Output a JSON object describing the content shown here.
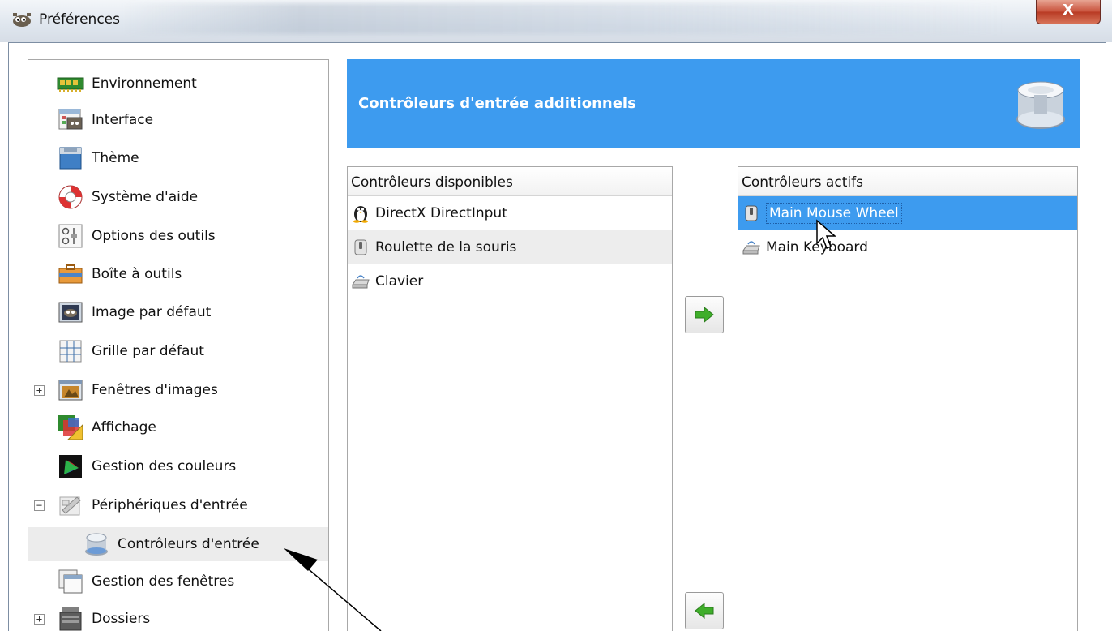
{
  "window": {
    "title": "Préférences",
    "close_label": "X"
  },
  "sidebar": {
    "items": [
      {
        "label": "Environnement",
        "icon": "memory-chip-icon"
      },
      {
        "label": "Interface",
        "icon": "interface-icon"
      },
      {
        "label": "Thème",
        "icon": "theme-icon"
      },
      {
        "label": "Système d'aide",
        "icon": "lifebuoy-icon"
      },
      {
        "label": "Options des outils",
        "icon": "tool-options-icon"
      },
      {
        "label": "Boîte à outils",
        "icon": "toolbox-icon"
      },
      {
        "label": "Image par défaut",
        "icon": "default-image-icon"
      },
      {
        "label": "Grille par défaut",
        "icon": "grid-icon"
      },
      {
        "label": "Fenêtres d'images",
        "icon": "image-windows-icon",
        "expander": "+"
      },
      {
        "label": "Affichage",
        "icon": "display-icon"
      },
      {
        "label": "Gestion des couleurs",
        "icon": "color-management-icon"
      },
      {
        "label": "Périphériques d'entrée",
        "icon": "input-devices-icon",
        "expander": "−"
      },
      {
        "label": "Contrôleurs d'entrée",
        "icon": "input-controllers-icon",
        "selected": true
      },
      {
        "label": "Gestion des fenêtres",
        "icon": "window-management-icon"
      },
      {
        "label": "Dossiers",
        "icon": "folders-icon",
        "expander": "+"
      }
    ]
  },
  "banner": {
    "title": "Contrôleurs d'entrée additionnels",
    "icon": "input-controller-large-icon"
  },
  "available": {
    "header": "Contrôleurs disponibles",
    "items": [
      {
        "label": "DirectX DirectInput",
        "icon": "tux-icon"
      },
      {
        "label": "Roulette de la souris",
        "icon": "mouse-wheel-icon"
      },
      {
        "label": "Clavier",
        "icon": "keyboard-icon"
      }
    ]
  },
  "active": {
    "header": "Contrôleurs actifs",
    "items": [
      {
        "label": "Main Mouse Wheel",
        "icon": "mouse-wheel-icon"
      },
      {
        "label": "Main Keyboard",
        "icon": "keyboard-icon"
      }
    ]
  },
  "buttons": {
    "add": "arrow-right-icon",
    "remove": "arrow-left-icon"
  },
  "colors": {
    "accent": "#3d9bef",
    "arrow_green": "#3fae2a"
  }
}
